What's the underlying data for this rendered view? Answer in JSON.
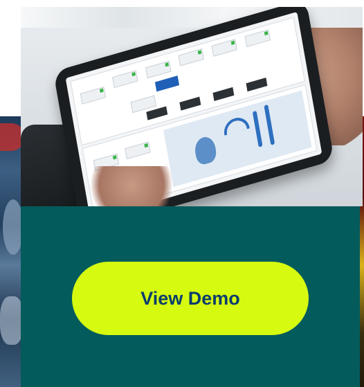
{
  "cta": {
    "button_label": "View Demo"
  },
  "colors": {
    "panel_background": "#045b5c",
    "button_background": "#d6fb11",
    "button_text": "#0b3d6b"
  },
  "images": {
    "hero_photo": "tablet-with-process-dashboard",
    "background_photo": "industrial-machinery"
  }
}
